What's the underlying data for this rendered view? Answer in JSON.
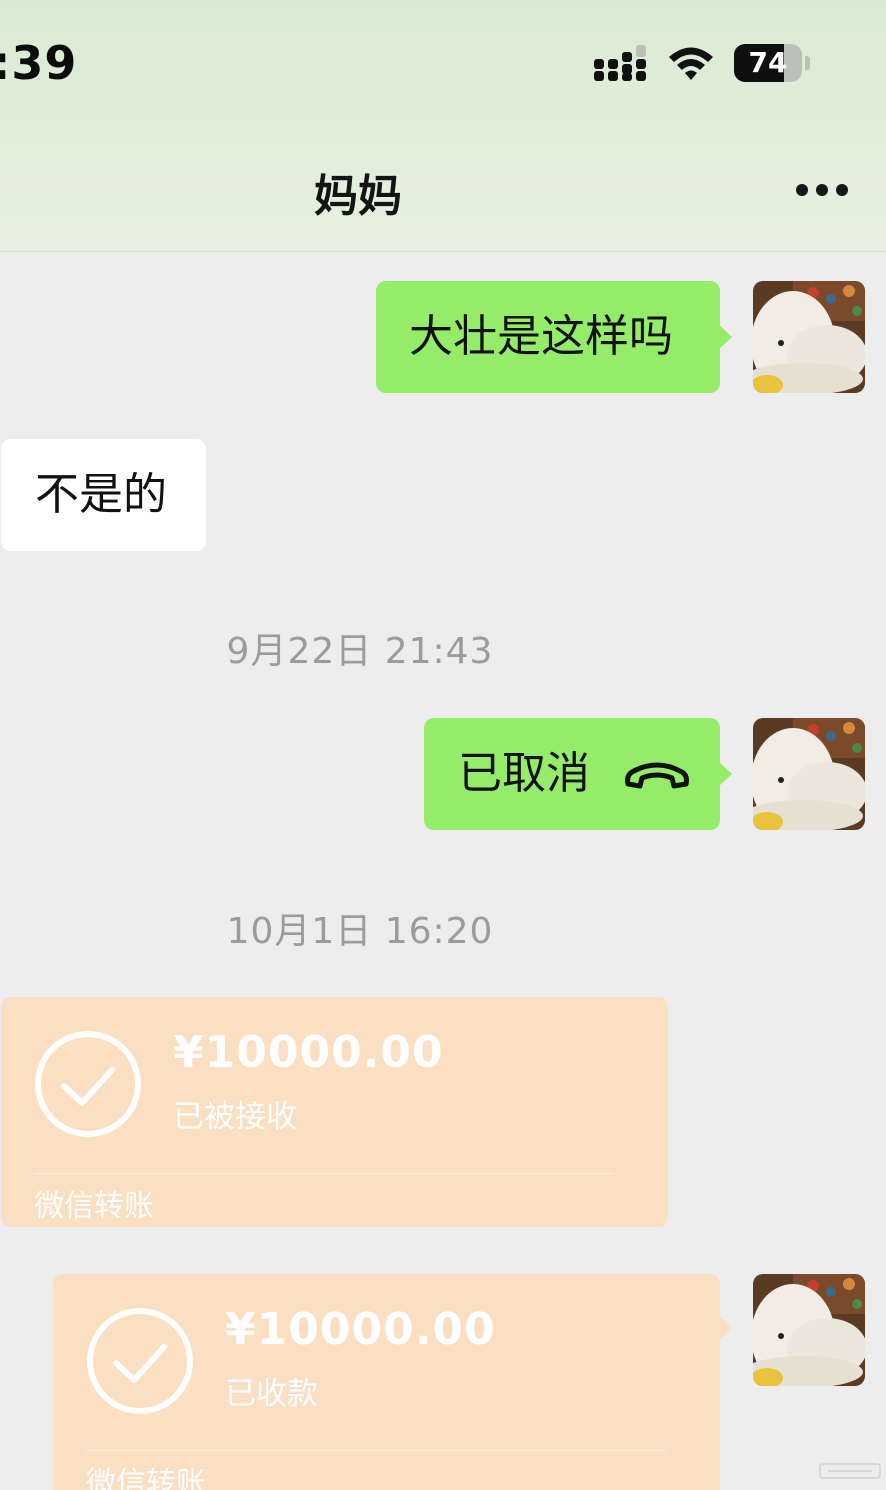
{
  "status_bar": {
    "time": ":39",
    "battery": "74",
    "battery_level": 0.74
  },
  "header": {
    "title": "妈妈",
    "more_icon": "ellipsis-icon"
  },
  "messages": [
    {
      "from": "me",
      "text": "大壮是这样吗"
    },
    {
      "from": "them",
      "text": "不是的"
    },
    {
      "timestamp": "9月22日 21:43"
    },
    {
      "from": "me",
      "text": "已取消",
      "icon": "phone-hangup-icon"
    },
    {
      "timestamp": "10月1日 16:20"
    },
    {
      "from": "them",
      "type": "transfer",
      "amount": "¥10000.00",
      "status": "已被接收",
      "brand": "微信转账"
    },
    {
      "from": "me",
      "type": "transfer",
      "amount": "¥10000.00",
      "status": "已收款",
      "brand": "微信转账"
    }
  ],
  "colors": {
    "header_bg": "#e2efdb",
    "chat_bg": "#ededed",
    "my_bubble": "#95ec69",
    "their_bubble": "#ffffff",
    "transfer_bg": "#fbdfc3",
    "timestamp_text": "#9b9b9b"
  }
}
